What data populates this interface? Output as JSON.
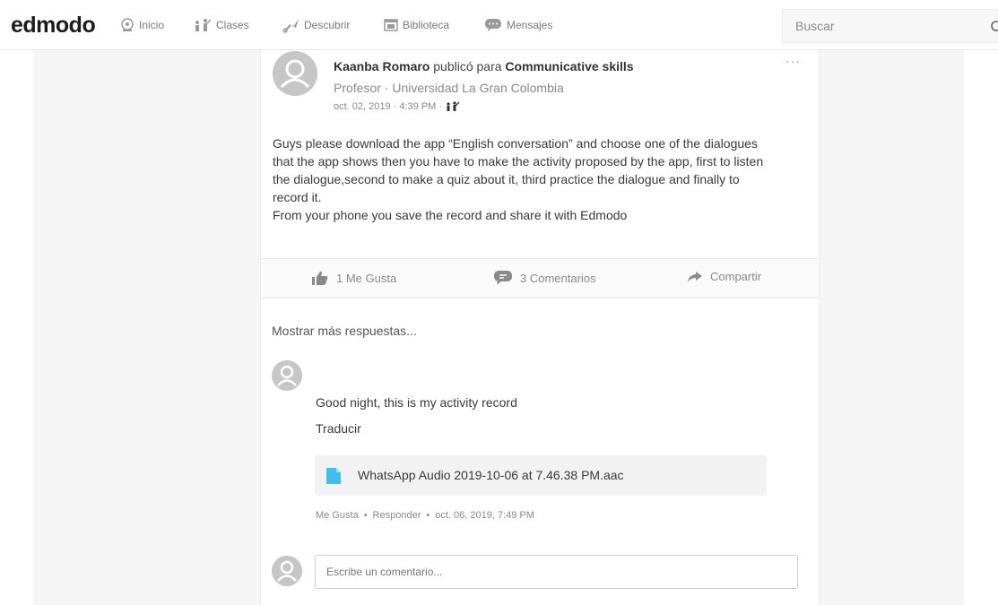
{
  "nav": {
    "logo": "edmodo",
    "items": [
      {
        "label": "Inicio",
        "icon": "home-icon"
      },
      {
        "label": "Clases",
        "icon": "classes-icon"
      },
      {
        "label": "Descubrir",
        "icon": "discover-icon"
      },
      {
        "label": "Biblioteca",
        "icon": "library-icon"
      },
      {
        "label": "Mensajes",
        "icon": "messages-icon"
      }
    ],
    "search_placeholder": "Buscar"
  },
  "post": {
    "author": "Kaanba Romaro",
    "published_for": "publicó para",
    "group": "Communicative skills",
    "role": "Profesor · Universidad La Gran Colombia",
    "date": "oct. 02, 2019 · 4:39 PM ·",
    "more": "···",
    "body_line1": "Guys please download the app “English conversation” and choose one of the dialogues",
    "body_line2": "that the app shows then you have to make the activity proposed by the app, first to listen",
    "body_line3": "the dialogue,second to make a quiz about it, third practice the dialogue and finally to",
    "body_line4": "record it.",
    "body_line5": "From your phone you save the record and share it  with Edmodo",
    "likes": "1 Me Gusta",
    "comments": "3 Comentarios",
    "share": "Compartir"
  },
  "replies": {
    "show_more": "Mostrar más respuestas...",
    "comment_text": "Good night, this is my activity record",
    "translate": "Traducir",
    "attachment_name": "WhatsApp Audio 2019-10-06 at 7.46.38 PM.aac",
    "like": "Me Gusta",
    "sep1": "•",
    "reply": "Responder",
    "sep2": "•",
    "comment_date": "oct. 06, 2019, 7:49 PM"
  },
  "composer": {
    "placeholder": "Escribe un comentario..."
  },
  "colors": {
    "accent": "#2f3b4c",
    "file_icon": "#3fc0e8"
  }
}
